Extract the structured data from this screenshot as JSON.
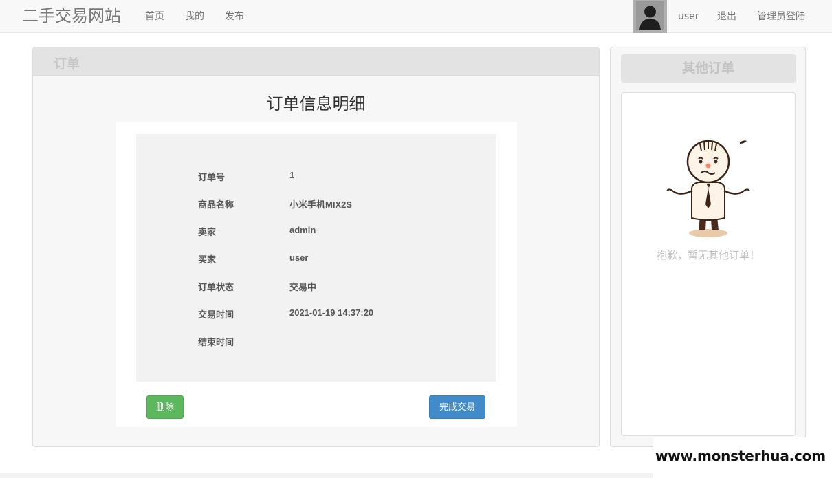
{
  "navbar": {
    "brand": "二手交易网站",
    "links": [
      "首页",
      "我的",
      "发布"
    ],
    "username": "user",
    "logout": "退出",
    "admin_login": "管理员登陆",
    "avatar_icon": "user-avatar-silhouette"
  },
  "order_panel": {
    "heading": "订单",
    "title": "订单信息明细",
    "rows": [
      {
        "label": "订单号",
        "value": "1"
      },
      {
        "label": "商品名称",
        "value": "小米手机MIX2S"
      },
      {
        "label": "卖家",
        "value": "admin"
      },
      {
        "label": "买家",
        "value": "user"
      },
      {
        "label": "订单状态",
        "value": "交易中"
      },
      {
        "label": "交易时间",
        "value": "2021-01-19 14:37:20"
      },
      {
        "label": "结束时间",
        "value": ""
      }
    ],
    "delete_button": "删除",
    "complete_button": "完成交易",
    "colors": {
      "delete": "#5cb85c",
      "complete": "#428bca"
    }
  },
  "other_orders": {
    "heading": "其他订单",
    "empty_text": "抱歉，暂无其他订单！",
    "illustration_icon": "confused-cartoon-character"
  },
  "watermark": {
    "text": "www.monsterhua.com"
  }
}
